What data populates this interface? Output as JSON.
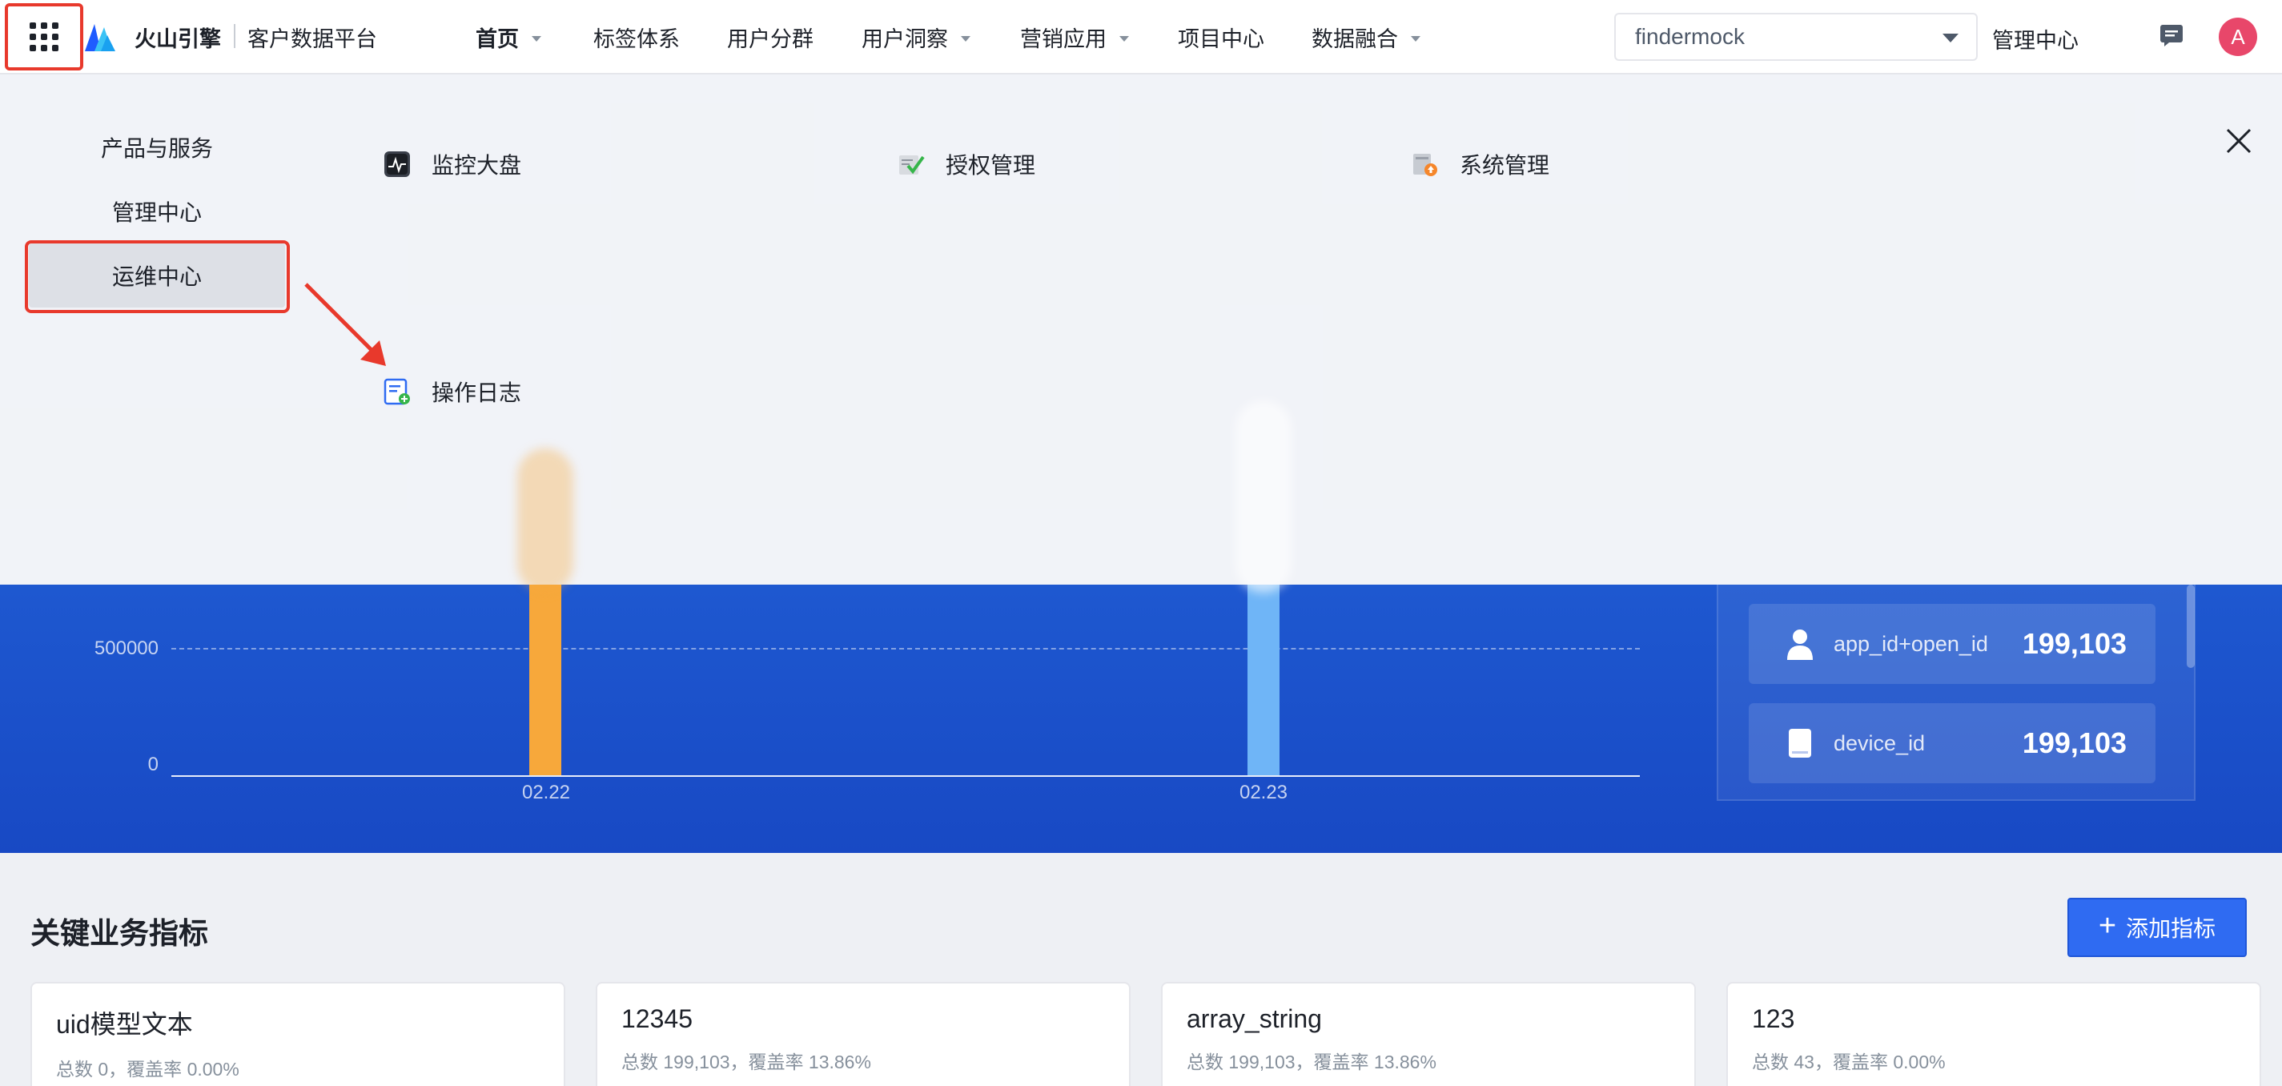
{
  "header": {
    "brand": "火山引擎",
    "platform": "客户数据平台",
    "nav": [
      {
        "label": "首页",
        "caret": true,
        "active": true
      },
      {
        "label": "标签体系",
        "caret": false
      },
      {
        "label": "用户分群",
        "caret": false
      },
      {
        "label": "用户洞察",
        "caret": true
      },
      {
        "label": "营销应用",
        "caret": true
      },
      {
        "label": "项目中心",
        "caret": false
      },
      {
        "label": "数据融合",
        "caret": true
      }
    ],
    "project_select": "findermock",
    "admin_center": "管理中心",
    "avatar_letter": "A"
  },
  "app_menu": {
    "categories": {
      "products": "产品与服务",
      "admin": "管理中心",
      "ops": "运维中心"
    },
    "links": {
      "monitor": "监控大盘",
      "auth": "授权管理",
      "system": "系统管理",
      "oplog": "操作日志"
    }
  },
  "chart_data": {
    "type": "bar",
    "categories": [
      "02.22",
      "02.23"
    ],
    "y_ticks": [
      "500000",
      "0"
    ],
    "series": [
      {
        "values": [
          null,
          null
        ],
        "colors": [
          "#f7a83b",
          "#6fb5f7"
        ]
      }
    ]
  },
  "id_stats": [
    {
      "name": "app_id+open_id",
      "value": "199,103",
      "icon": "user-icon"
    },
    {
      "name": "device_id",
      "value": "199,103",
      "icon": "device-icon"
    }
  ],
  "kpi": {
    "title": "关键业务指标",
    "add_button": "添加指标",
    "cards": [
      {
        "title": "uid模型文本",
        "subtitle": "总数 0，覆盖率 0.00%"
      },
      {
        "title": "12345",
        "subtitle": "总数 199,103，覆盖率 13.86%"
      },
      {
        "title": "array_string",
        "subtitle": "总数 199,103，覆盖率 13.86%"
      },
      {
        "title": "123",
        "subtitle": "总数 43，覆盖率 0.00%"
      }
    ]
  },
  "colors": {
    "primary": "#2f6bf2",
    "highlight_red": "#e8392c",
    "band_blue": "#1e58d0"
  }
}
